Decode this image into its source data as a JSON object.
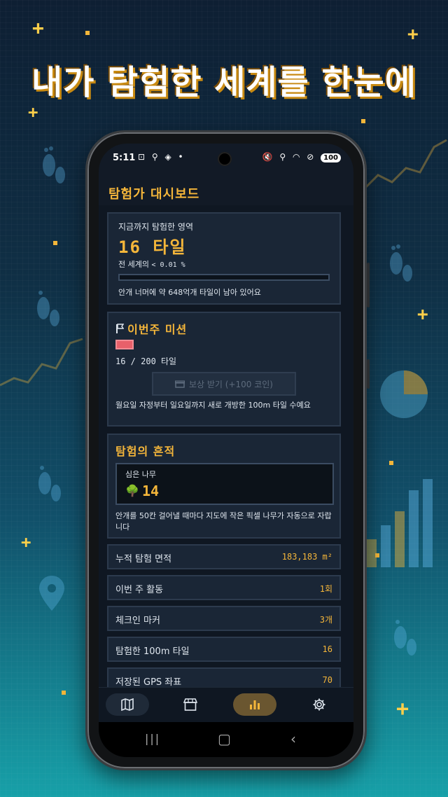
{
  "headline": "내가 탐험한 세계를 한눈에",
  "status": {
    "time": "5:11",
    "left_icons": "⊡ ⚲ ◈ •",
    "right_icons": "🔇 ⚲ ◠ ⊘",
    "battery": "100"
  },
  "app": {
    "title": "탐험가 대시보드"
  },
  "explored": {
    "caption": "지금까지 탐험한 영역",
    "value": "16 타일",
    "share_prefix": "전 세계의",
    "share_value": "< 0.01 %",
    "progress": 0.0,
    "remaining": "안개 너머에 약 648억개 타일이 남아 있어요"
  },
  "mission": {
    "flag_icon": "flag-icon",
    "title": "이번주 미션",
    "progress_text": "16 / 200 타일",
    "progress": 0.08,
    "reward_button": "보상 받기 (+100 코인)",
    "description": "월요일 자정부터 일요일까지 새로 개방한 100m 타일 수예요"
  },
  "traces": {
    "title": "탐험의 흔적",
    "tree_label": "심은 나무",
    "tree_icon": "tree-icon",
    "tree_count": "14",
    "description": "안개를 50칸 걸어낼 때마다 지도에 작은 픽셀 나무가 자동으로 자랍니다"
  },
  "stats": [
    {
      "label": "누적 탐험 면적",
      "value": "183,183 m²"
    },
    {
      "label": "이번 주 활동",
      "value": "1회"
    },
    {
      "label": "체크인 마커",
      "value": "3개"
    },
    {
      "label": "탐험한 100m 타일",
      "value": "16"
    },
    {
      "label": "저장된 GPS 좌표",
      "value": "70"
    }
  ],
  "nav": [
    {
      "name": "map",
      "icon": "map-icon",
      "active": false
    },
    {
      "name": "store",
      "icon": "store-icon",
      "active": false
    },
    {
      "name": "stats",
      "icon": "bar-chart-icon",
      "active": true
    },
    {
      "name": "settings",
      "icon": "gear-icon",
      "active": false
    }
  ],
  "colors": {
    "accent": "#f5b63a",
    "card": "#1a2636",
    "danger": "#e8606a"
  }
}
